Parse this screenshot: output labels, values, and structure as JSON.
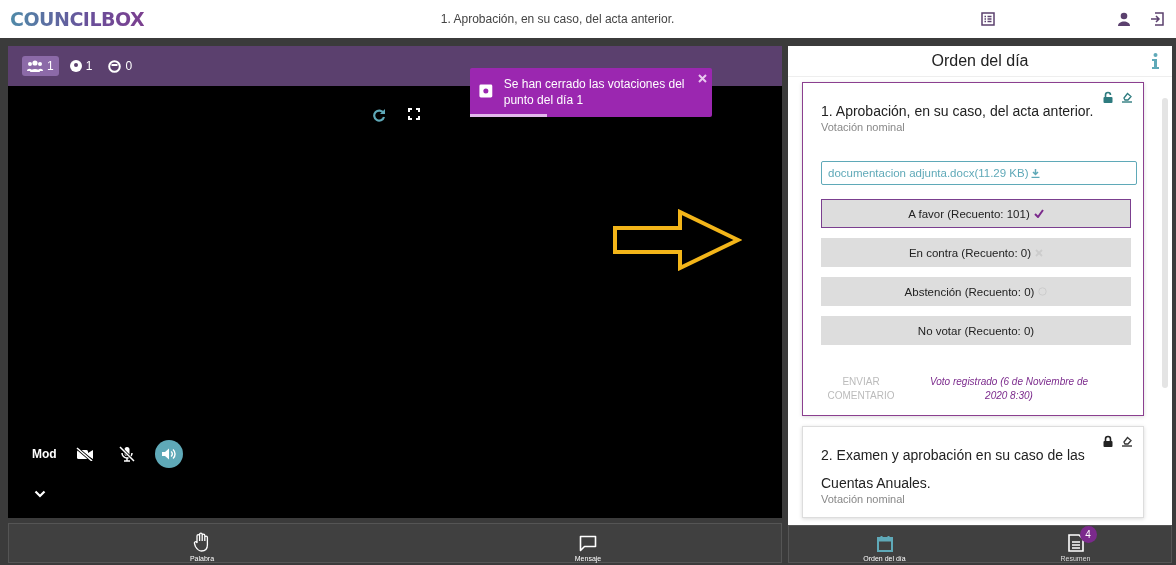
{
  "header": {
    "logo": "COUNCILBOX",
    "title": "1. Aprobación, en su caso, del acta anterior."
  },
  "participants": [
    {
      "kind": "people",
      "count": "1",
      "selected": true
    },
    {
      "kind": "pin",
      "count": "1",
      "selected": false
    },
    {
      "kind": "face",
      "count": "0",
      "selected": false
    }
  ],
  "toast": {
    "text": "Se han cerrado las votaciones del punto del día 1",
    "level": 0.32
  },
  "video": {
    "label": "Mod",
    "controls": [
      {
        "kind": "camera",
        "on": false
      },
      {
        "kind": "mic",
        "on": false
      },
      {
        "kind": "speaker",
        "on": true
      }
    ]
  },
  "left_toolbar": [
    {
      "kind": "hand",
      "label": "Palabra"
    },
    {
      "kind": "chat",
      "label": "Mensaje"
    }
  ],
  "agenda": {
    "title": "Orden del día",
    "items": [
      {
        "title": "1. Aprobación, en su caso, del acta anterior.",
        "subtitle": "Votación nominal",
        "locked": false,
        "selected": true,
        "attachment": "documentacion adjunta.docx(11.29 KB)",
        "options": [
          {
            "kind": "favor",
            "label": "A favor (Recuento: 101)",
            "selected": true
          },
          {
            "kind": "contra",
            "label": "En contra (Recuento: 0)",
            "selected": false
          },
          {
            "kind": "abstencion",
            "label": "Abstención (Recuento: 0)",
            "selected": false
          },
          {
            "kind": "none",
            "label": "No votar (Recuento: 0)",
            "selected": false
          }
        ],
        "comment_button": "ENVIAR COMENTARIO",
        "vote_status": "Voto registrado (6 de Noviembre de 2020 8:30)"
      },
      {
        "title": "2. Examen y aprobación en su caso de las Cuentas Anuales.",
        "subtitle": "Votación nominal",
        "locked": true,
        "selected": false
      }
    ]
  },
  "right_toolbar": [
    {
      "kind": "calendar",
      "label": "Orden del día",
      "selected": true
    },
    {
      "kind": "doc",
      "label": "Resumen",
      "selected": false,
      "badge": "4"
    }
  ]
}
